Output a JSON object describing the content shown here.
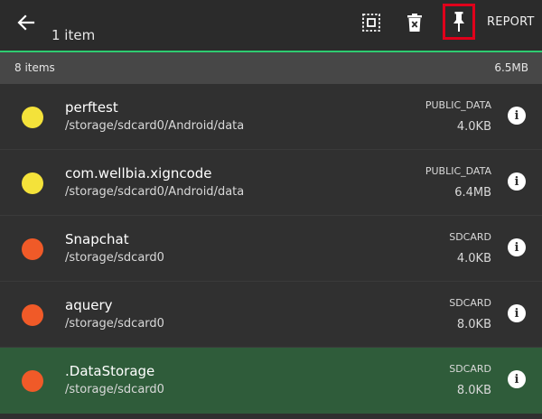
{
  "header": {
    "title": "1 item",
    "report_label": "REPORT",
    "icons": [
      "back-arrow-icon",
      "select-all-icon",
      "delete-icon",
      "pin-icon"
    ]
  },
  "summary": {
    "count": "8 items",
    "total_size": "6.5MB"
  },
  "items": [
    {
      "name": "perftest",
      "path": "/storage/sdcard0/Android/data",
      "location": "PUBLIC_DATA",
      "size": "4.0KB",
      "dot_color": "#f4e23a",
      "selected": false
    },
    {
      "name": "com.wellbia.xigncode",
      "path": "/storage/sdcard0/Android/data",
      "location": "PUBLIC_DATA",
      "size": "6.4MB",
      "dot_color": "#f4e23a",
      "selected": false
    },
    {
      "name": "Snapchat",
      "path": "/storage/sdcard0",
      "location": "SDCARD",
      "size": "4.0KB",
      "dot_color": "#f05a28",
      "selected": false
    },
    {
      "name": "aquery",
      "path": "/storage/sdcard0",
      "location": "SDCARD",
      "size": "8.0KB",
      "dot_color": "#f05a28",
      "selected": false
    },
    {
      "name": ".DataStorage",
      "path": "/storage/sdcard0",
      "location": "SDCARD",
      "size": "8.0KB",
      "dot_color": "#f05a28",
      "selected": true
    }
  ],
  "colors": {
    "accent": "#2ecc71",
    "selected_row": "#2f5c3a",
    "highlight_box": "#e0001b"
  }
}
